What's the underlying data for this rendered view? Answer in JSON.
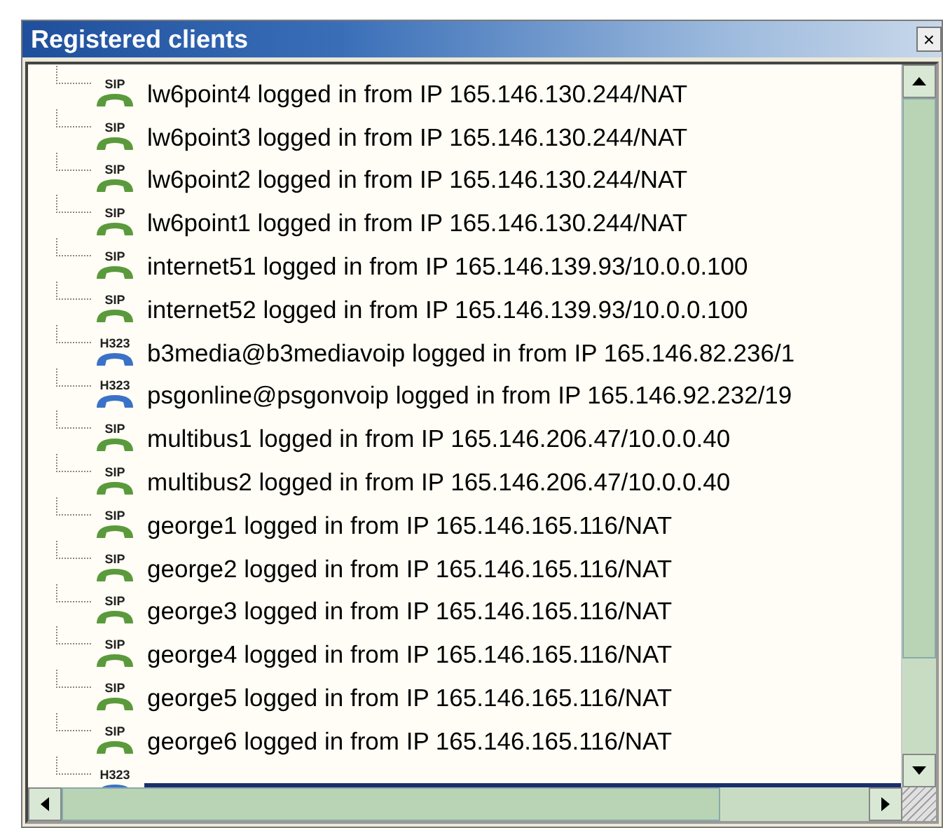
{
  "window": {
    "title": "Registered clients",
    "close": "×"
  },
  "clients": [
    {
      "kind": "sip",
      "badge": "SIP",
      "text": "lw6point4 logged in from IP 165.146.130.244/NAT",
      "selected": false
    },
    {
      "kind": "sip",
      "badge": "SIP",
      "text": "lw6point3 logged in from IP 165.146.130.244/NAT",
      "selected": false
    },
    {
      "kind": "sip",
      "badge": "SIP",
      "text": "lw6point2 logged in from IP 165.146.130.244/NAT",
      "selected": false
    },
    {
      "kind": "sip",
      "badge": "SIP",
      "text": "lw6point1 logged in from IP 165.146.130.244/NAT",
      "selected": false
    },
    {
      "kind": "sip",
      "badge": "SIP",
      "text": "internet51 logged in from IP 165.146.139.93/10.0.0.100",
      "selected": false
    },
    {
      "kind": "sip",
      "badge": "SIP",
      "text": "internet52 logged in from IP 165.146.139.93/10.0.0.100",
      "selected": false
    },
    {
      "kind": "h323",
      "badge": "H323",
      "text": "b3media@b3mediavoip logged in from IP 165.146.82.236/1",
      "selected": false
    },
    {
      "kind": "h323",
      "badge": "H323",
      "text": "psgonline@psgonvoip logged in from IP 165.146.92.232/19",
      "selected": false
    },
    {
      "kind": "sip",
      "badge": "SIP",
      "text": "multibus1 logged in from IP 165.146.206.47/10.0.0.40",
      "selected": false
    },
    {
      "kind": "sip",
      "badge": "SIP",
      "text": "multibus2 logged in from IP 165.146.206.47/10.0.0.40",
      "selected": false
    },
    {
      "kind": "sip",
      "badge": "SIP",
      "text": "george1 logged in from IP 165.146.165.116/NAT",
      "selected": false
    },
    {
      "kind": "sip",
      "badge": "SIP",
      "text": "george2 logged in from IP 165.146.165.116/NAT",
      "selected": false
    },
    {
      "kind": "sip",
      "badge": "SIP",
      "text": "george3 logged in from IP 165.146.165.116/NAT",
      "selected": false
    },
    {
      "kind": "sip",
      "badge": "SIP",
      "text": "george4 logged in from IP 165.146.165.116/NAT",
      "selected": false
    },
    {
      "kind": "sip",
      "badge": "SIP",
      "text": "george5 logged in from IP 165.146.165.116/NAT",
      "selected": false
    },
    {
      "kind": "sip",
      "badge": "SIP",
      "text": "george6 logged in from IP 165.146.165.116/NAT",
      "selected": false
    },
    {
      "kind": "h323",
      "badge": "H323",
      "selected": true
    }
  ]
}
